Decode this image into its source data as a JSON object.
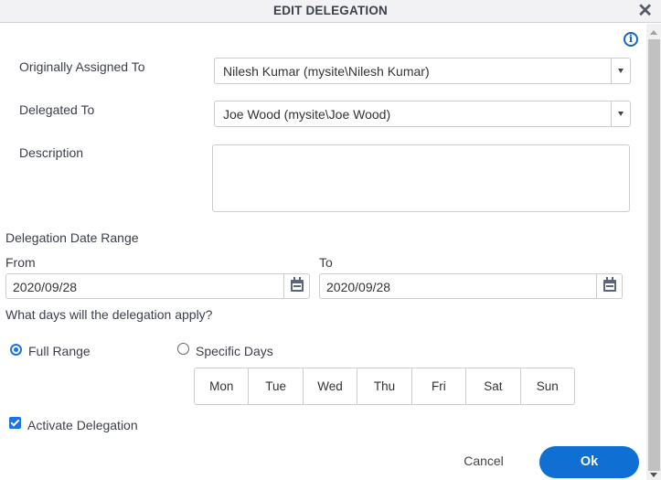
{
  "dialog": {
    "title": "EDIT DELEGATION",
    "close_icon": "close-icon",
    "info_icon": "info-icon",
    "info_glyph": "i",
    "close_glyph": "✕"
  },
  "form": {
    "originally_assigned_label": "Originally Assigned To",
    "originally_assigned_value": "Nilesh Kumar (mysite\\Nilesh Kumar)",
    "delegated_to_label": "Delegated To",
    "delegated_to_value": "Joe Wood (mysite\\Joe Wood)",
    "description_label": "Description",
    "description_value": "",
    "date_range_label": "Delegation Date Range",
    "from_label": "From",
    "from_value": "2020/09/28",
    "to_label": "To",
    "to_value": "2020/09/28",
    "days_question": "What days will the delegation apply?",
    "full_range_label": "Full Range",
    "full_range_selected": true,
    "specific_days_label": "Specific Days",
    "specific_days_selected": false,
    "days": [
      "Mon",
      "Tue",
      "Wed",
      "Thu",
      "Fri",
      "Sat",
      "Sun"
    ],
    "activate_label": "Activate Delegation",
    "activate_checked": true
  },
  "buttons": {
    "cancel": "Cancel",
    "ok": "Ok"
  },
  "colors": {
    "accent": "#0f6fd2",
    "titlebar": "#f2f2f4"
  }
}
